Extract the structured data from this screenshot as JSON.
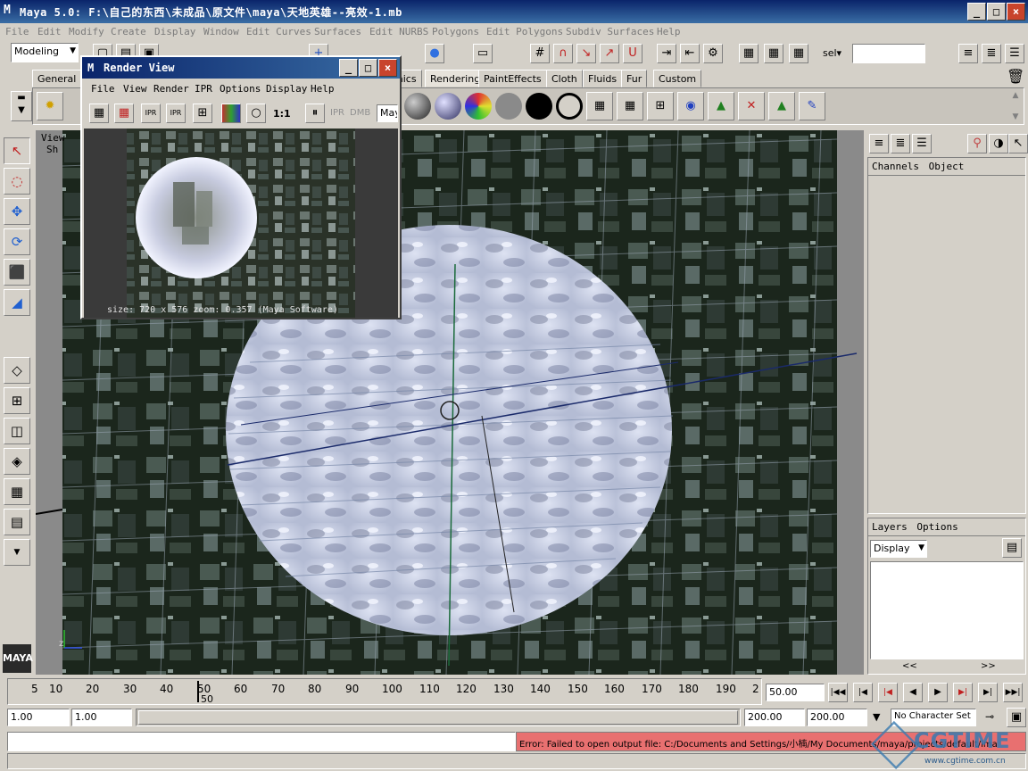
{
  "window": {
    "title": "Maya 5.0: F:\\自己的东西\\未成品\\原文件\\maya\\天地英雄--亮效-1.mb",
    "logo": "M"
  },
  "menubar": [
    "File",
    "Edit",
    "Modify",
    "Create",
    "Display",
    "Window",
    "Edit Curves",
    "Surfaces",
    "Edit NURBS",
    "Polygons",
    "Edit Polygons",
    "Subdiv Surfaces",
    "Help"
  ],
  "statusline": {
    "mode": "Modeling",
    "sel_label": "sel▾",
    "sel_value": ""
  },
  "shelf_tabs": [
    "General",
    "Dynamics",
    "Rendering",
    "PaintEffects",
    "Cloth",
    "Fluids",
    "Fur",
    "Custom"
  ],
  "shelf_tab_partial": "mics",
  "active_shelf_tab": "Rendering",
  "panel_menu": [
    "View",
    "Sh"
  ],
  "render_view": {
    "title": "Render View",
    "menu": [
      "File",
      "View",
      "Render",
      "IPR",
      "Options",
      "Display",
      "Help"
    ],
    "ratio_label": "1:1",
    "ipr_label": "IPR",
    "dmb_label": "DMB",
    "renderer_label": "May",
    "status": "size:  720 x 576  zoom: 0.357   (Maya Software)"
  },
  "channel_box": {
    "header": [
      "Channels",
      "Object"
    ]
  },
  "layer_editor": {
    "header": [
      "Layers",
      "Options"
    ],
    "display_dropdown": "Display",
    "scroll_left": "<<",
    "scroll_right": ">>"
  },
  "time_slider": {
    "ticks": [
      "5",
      "10",
      "20",
      "30",
      "40",
      "50",
      "60",
      "70",
      "80",
      "90",
      "100",
      "110",
      "120",
      "130",
      "140",
      "150",
      "160",
      "170",
      "180",
      "190",
      "2"
    ],
    "current_frame": "50",
    "current_time_field": "50.00"
  },
  "range_slider": {
    "start": "1.00",
    "start_range": "1.00",
    "end_range": "200.00",
    "end": "200.00",
    "character_set": "No Character Set"
  },
  "command_line": {
    "input": "",
    "error": "Error: Failed to open output file: C:/Documents and Settings/小楠/My Documents/maya/projects/default/ima"
  },
  "watermark": {
    "brand": "CGTIME",
    "url": "www.cgtime.com.cn"
  },
  "colors": {
    "title_bar": "#0a246a",
    "error_bg": "#e87070",
    "viewport_bg": "#1a2418"
  }
}
